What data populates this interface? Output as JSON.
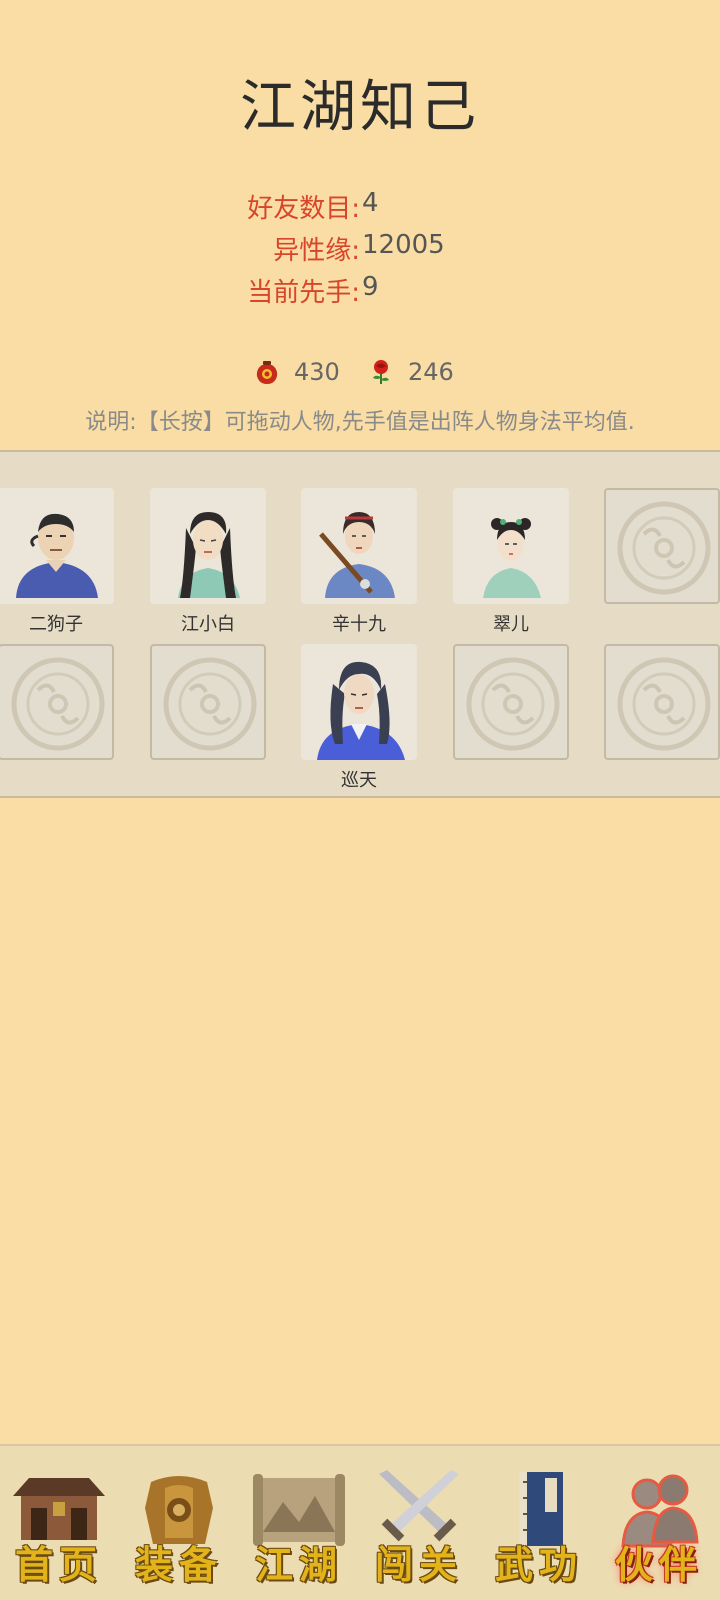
{
  "header": {
    "title": "江湖知己"
  },
  "stats": [
    {
      "label": "好友数目:",
      "value": "4"
    },
    {
      "label": "异性缘:",
      "value": "12005"
    },
    {
      "label": "当前先手:",
      "value": "9"
    }
  ],
  "currency": [
    {
      "icon": "wine-jar-icon",
      "value": "430"
    },
    {
      "icon": "rose-icon",
      "value": "246"
    }
  ],
  "note": "说明:【长按】可拖动人物,先手值是出阵人物身法平均值.",
  "roster": {
    "slots": [
      {
        "name": "二狗子",
        "occupied": true
      },
      {
        "name": "江小白",
        "occupied": true
      },
      {
        "name": "辛十九",
        "occupied": true
      },
      {
        "name": "翠儿",
        "occupied": true
      },
      {
        "name": "",
        "occupied": false
      },
      {
        "name": "",
        "occupied": false
      },
      {
        "name": "",
        "occupied": false
      },
      {
        "name": "巡天",
        "occupied": true
      },
      {
        "name": "",
        "occupied": false
      },
      {
        "name": "",
        "occupied": false
      }
    ]
  },
  "nav": [
    {
      "label": "首页",
      "icon": "house-icon",
      "active": false
    },
    {
      "label": "装备",
      "icon": "armor-icon",
      "active": false
    },
    {
      "label": "江湖",
      "icon": "scroll-map-icon",
      "active": false
    },
    {
      "label": "闯关",
      "icon": "crossed-swords-icon",
      "active": false
    },
    {
      "label": "武功",
      "icon": "book-icon",
      "active": false
    },
    {
      "label": "伙伴",
      "icon": "companions-icon",
      "active": true
    }
  ],
  "colors": {
    "background": "#f9dda4",
    "label_red": "#d9452a",
    "nav_gold": "#e3b41a"
  }
}
